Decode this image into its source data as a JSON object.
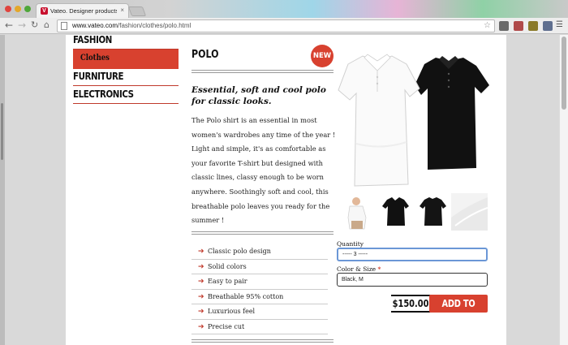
{
  "browser": {
    "tab_title": "Vateo. Designer products",
    "tab_close": "×",
    "favicon_letter": "V",
    "url_host": "www.vateo.com",
    "url_path": "/fashion/clothes/polo.html",
    "icons": [
      "back-arrow-icon",
      "forward-arrow-icon",
      "reload-icon",
      "home-icon",
      "bookmark-star-icon",
      "menu-icon"
    ]
  },
  "sidebar": {
    "categories": [
      {
        "label": "FASHION"
      },
      {
        "label": "Clothes",
        "active": true
      },
      {
        "label": "FURNITURE"
      },
      {
        "label": "ELECTRONICS"
      }
    ]
  },
  "product": {
    "name": "POLO",
    "badge": "NEW",
    "tagline": "Essential, soft and cool polo for classic looks.",
    "description": "The Polo shirt is an essential in most women's wardrobes any time of the year ! Light and simple, it's as comfortable as your favorite T-shirt but designed with classic lines, classy enough to be worn anywhere. Soothingly soft and cool, this breathable polo leaves you ready for the summer !",
    "features": [
      "Classic polo design",
      "Solid colors",
      "Easy to pair",
      "Breathable 95% cotton",
      "Luxurious feel",
      "Precise cut"
    ],
    "price": "$150.00",
    "add_to_cart_label": "ADD TO CART"
  },
  "form": {
    "quantity_label": "Quantity",
    "quantity_value": "----- 3 -----",
    "color_size_label": "Color & Size",
    "color_size_required_mark": "*",
    "color_size_value": "Black, M"
  },
  "colors": {
    "accent": "#d8412f",
    "focus_ring": "#6b97d6"
  }
}
